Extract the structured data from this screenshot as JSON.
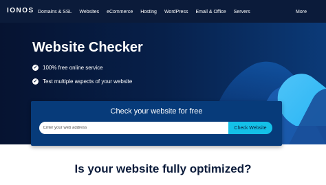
{
  "nav": {
    "logo": "IONOS",
    "items": [
      "Domains & SSL",
      "Websites",
      "eCommerce",
      "Hosting",
      "WordPress",
      "Email & Office",
      "Servers"
    ],
    "more": "More"
  },
  "hero": {
    "title": "Website Checker",
    "checks": [
      "100% free online service",
      "Test multiple aspects of your website"
    ]
  },
  "checker": {
    "heading": "Check your website for free",
    "input_placeholder": "Enter your web address",
    "input_value": "",
    "button_label": "Check Website"
  },
  "section": {
    "heading": "Is your website fully optimized?"
  },
  "colors": {
    "nav_bg": "#0b1b3a",
    "hero_dark": "#061331",
    "card_bg": "#073b7a",
    "accent": "#14c1e8",
    "accent_light": "#5ad1f0"
  },
  "icons": [
    "check-icon"
  ]
}
